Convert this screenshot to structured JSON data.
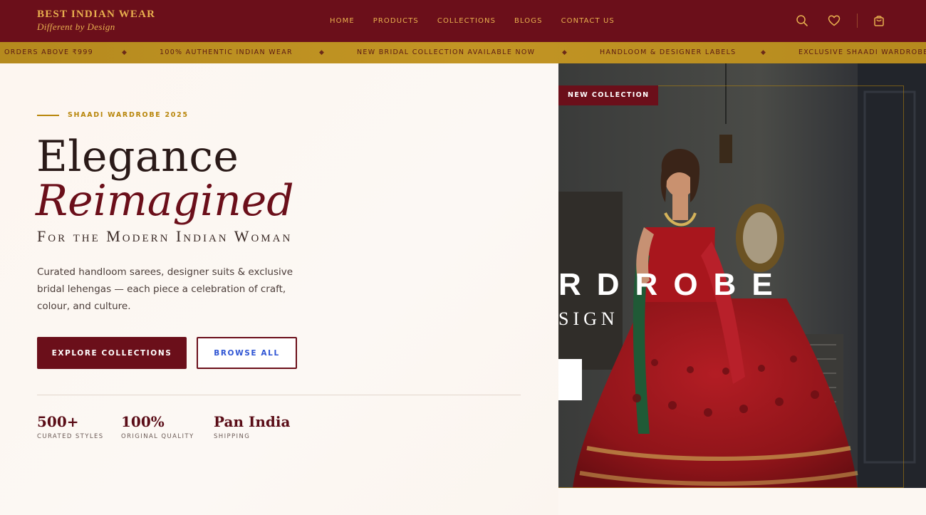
{
  "brand": {
    "name": "Best Indian Wear",
    "tagline": "Different by Design"
  },
  "nav": {
    "items": [
      "HOME",
      "PRODUCTS",
      "COLLECTIONS",
      "BLOGS",
      "CONTACT US"
    ]
  },
  "header_icons": [
    "search-icon",
    "heart-icon",
    "shopping-bag-icon"
  ],
  "ticker": {
    "items": [
      "ORDERS ABOVE ₹999",
      "100% AUTHENTIC INDIAN WEAR",
      "NEW BRIDAL COLLECTION AVAILABLE NOW",
      "HANDLOOM & DESIGNER LABELS",
      "EXCLUSIVE SHAADI WARDROBE"
    ],
    "separator": "◆"
  },
  "hero": {
    "eyebrow": "SHAADI WARDROBE 2025",
    "title_line1": "Elegance",
    "title_line2": "Reimagined",
    "subtitle": "For the Modern Indian Woman",
    "description": "Curated handloom sarees, designer suits & exclusive bridal lehengas — each piece a celebration of craft, colour, and culture.",
    "primary_button": "EXPLORE COLLECTIONS",
    "secondary_button": "BROWSE ALL",
    "stats": [
      {
        "value": "500+",
        "label": "CURATED STYLES"
      },
      {
        "value": "100%",
        "label": "ORIGINAL QUALITY"
      },
      {
        "value": "Pan India",
        "label": "SHIPPING"
      }
    ]
  },
  "hero_image": {
    "badge": "NEW COLLECTION",
    "overlay_text_big": "RDROBE",
    "overlay_text_small": "SIGN"
  },
  "colors": {
    "maroon": "#6b0f1a",
    "gold": "#e8b04f",
    "ticker": "#b58a1e",
    "cream": "#fcf7f2"
  }
}
